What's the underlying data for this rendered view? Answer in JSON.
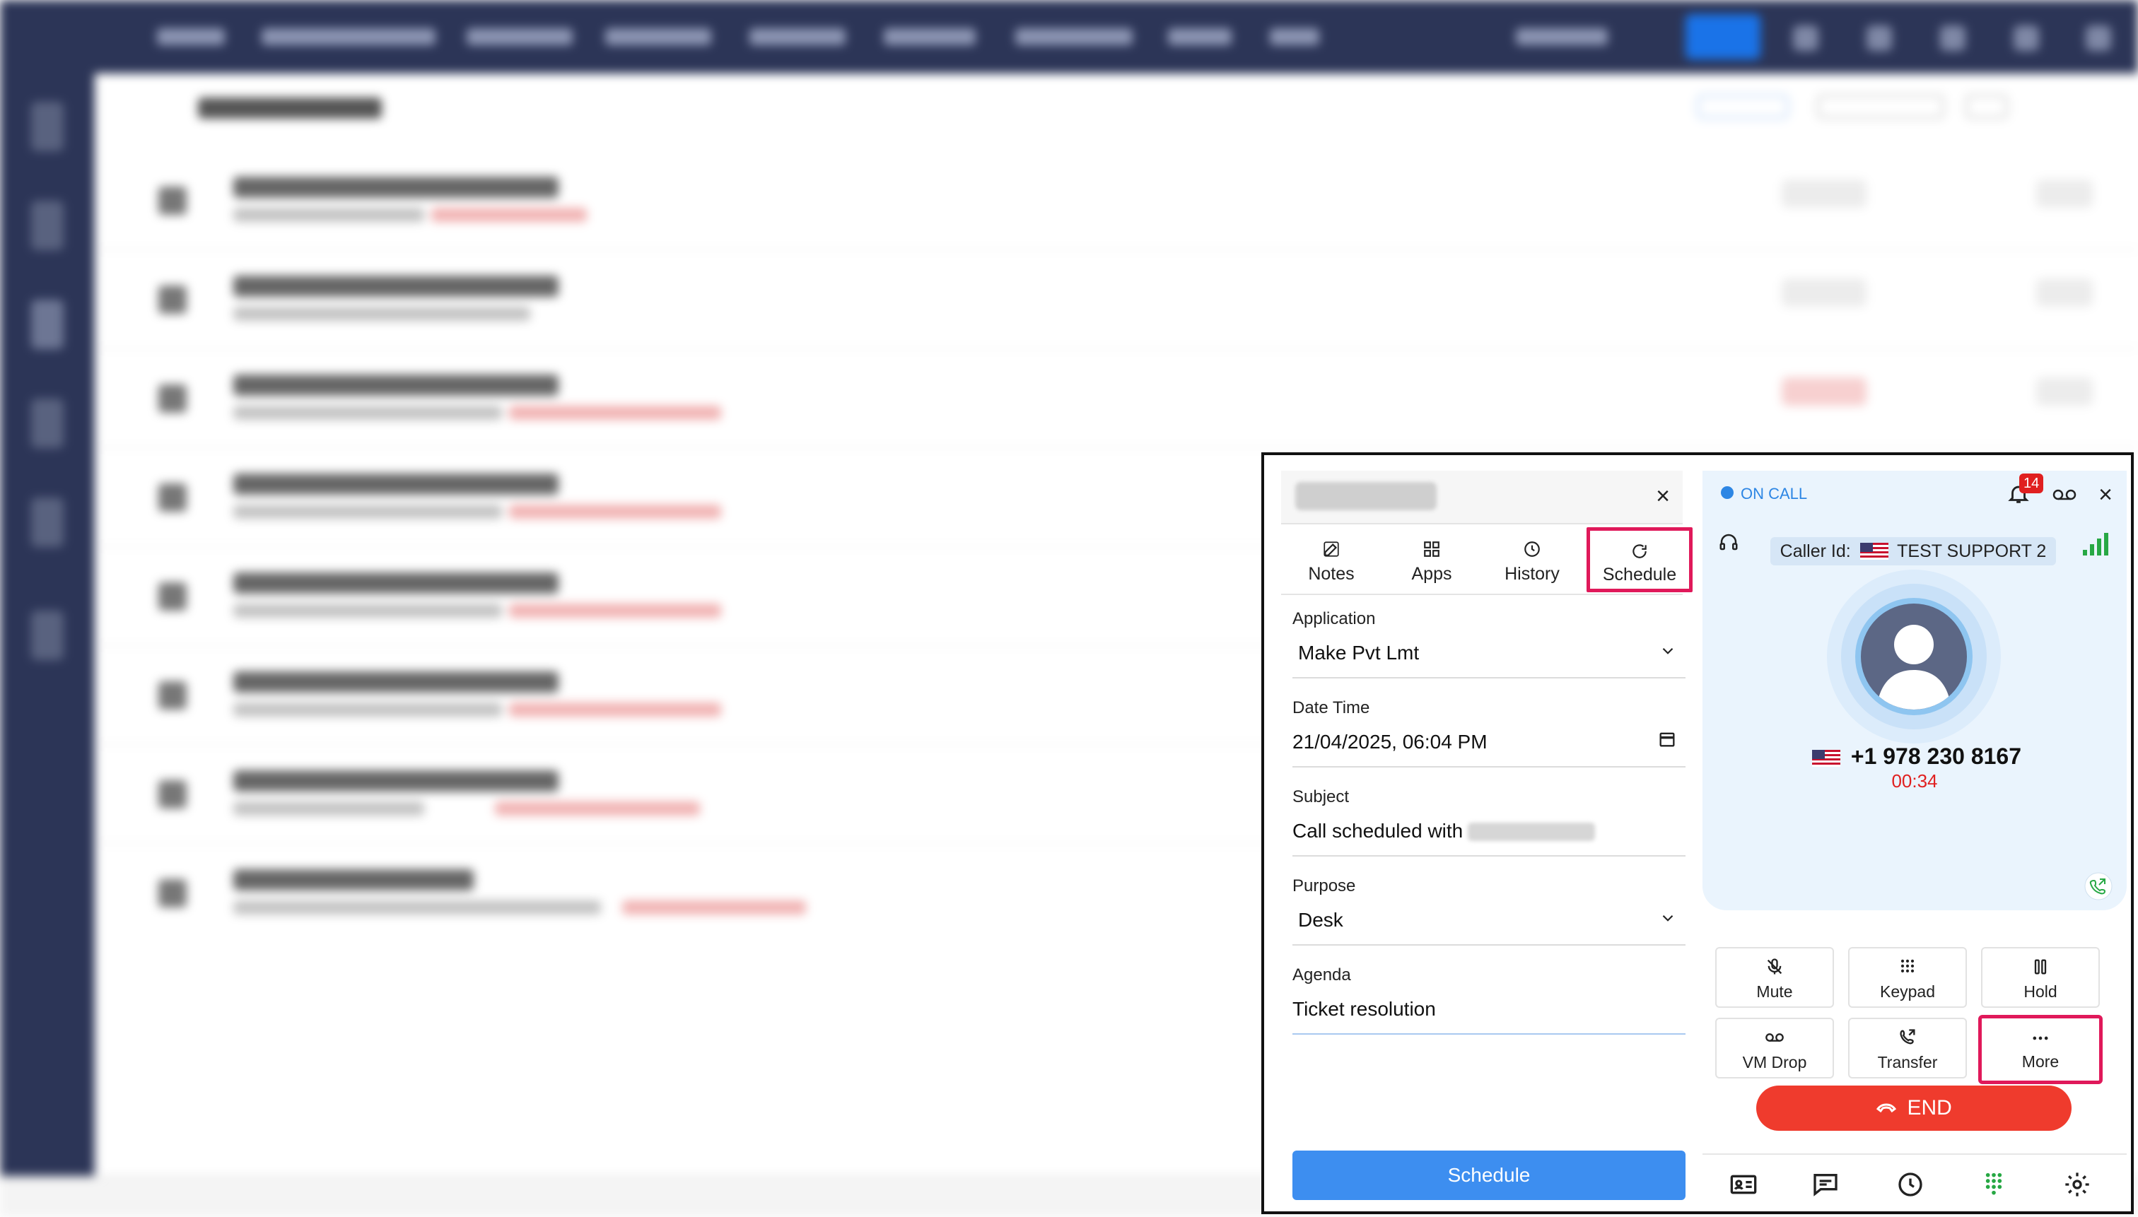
{
  "left_panel": {
    "tabs": [
      {
        "label": "Notes",
        "icon": "edit-icon"
      },
      {
        "label": "Apps",
        "icon": "grid-icon"
      },
      {
        "label": "History",
        "icon": "clock-icon"
      },
      {
        "label": "Schedule",
        "icon": "refresh-icon",
        "active": true
      }
    ],
    "fields": {
      "application": {
        "label": "Application",
        "value": "Make Pvt Lmt"
      },
      "datetime": {
        "label": "Date Time",
        "value": "21/04/2025, 06:04 PM"
      },
      "subject": {
        "label": "Subject",
        "value": "Call scheduled with"
      },
      "purpose": {
        "label": "Purpose",
        "value": "Desk"
      },
      "agenda": {
        "label": "Agenda",
        "value": "Ticket resolution"
      }
    },
    "schedule_button": "Schedule"
  },
  "call": {
    "status": "ON CALL",
    "notifications": "14",
    "caller_id_label": "Caller Id:",
    "caller_name": "TEST SUPPORT 2",
    "phone_number": "+1 978 230 8167",
    "timer": "00:34",
    "controls": [
      {
        "label": "Mute",
        "icon": "mic-off-icon"
      },
      {
        "label": "Keypad",
        "icon": "keypad-icon"
      },
      {
        "label": "Hold",
        "icon": "pause-icon"
      },
      {
        "label": "VM Drop",
        "icon": "voicemail-icon"
      },
      {
        "label": "Transfer",
        "icon": "call-transfer-icon"
      },
      {
        "label": "More",
        "icon": "more-icon"
      }
    ],
    "end_button": "END"
  },
  "colors": {
    "accent": "#3d8ef0",
    "highlight": "#e0195a",
    "end": "#ef3b2d",
    "status": "#2d86e4"
  }
}
